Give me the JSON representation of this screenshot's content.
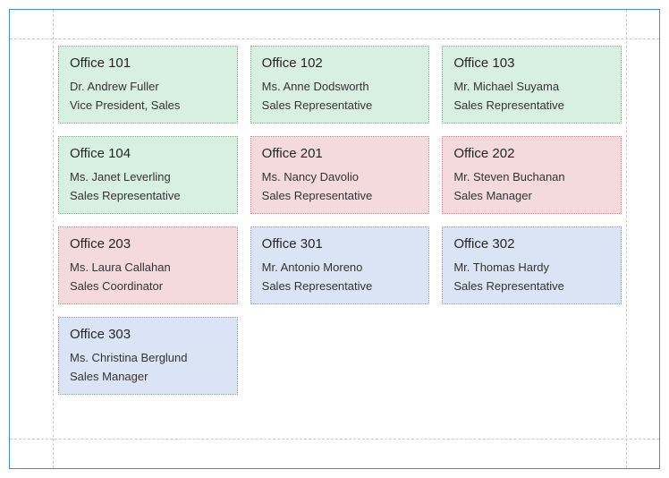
{
  "colors": {
    "green": {
      "bg": "#d8f0e2",
      "border": "#6fb98a"
    },
    "pink": {
      "bg": "#f4dadd",
      "border": "#cf8a93"
    },
    "blue": {
      "bg": "#dbe4f4",
      "border": "#8aa1cf"
    },
    "page_border": "#3a8fd6"
  },
  "cards": [
    {
      "office": "Office 101",
      "person": "Dr. Andrew Fuller",
      "role": "Vice President, Sales",
      "color": "green"
    },
    {
      "office": "Office 102",
      "person": "Ms. Anne Dodsworth",
      "role": "Sales Representative",
      "color": "green"
    },
    {
      "office": "Office 103",
      "person": "Mr. Michael Suyama",
      "role": "Sales Representative",
      "color": "green"
    },
    {
      "office": "Office 104",
      "person": "Ms. Janet Leverling",
      "role": "Sales Representative",
      "color": "green"
    },
    {
      "office": "Office 201",
      "person": "Ms. Nancy Davolio",
      "role": "Sales Representative",
      "color": "pink"
    },
    {
      "office": "Office 202",
      "person": "Mr. Steven Buchanan",
      "role": "Sales Manager",
      "color": "pink"
    },
    {
      "office": "Office 203",
      "person": "Ms. Laura Callahan",
      "role": "Sales Coordinator",
      "color": "pink"
    },
    {
      "office": "Office 301",
      "person": "Mr. Antonio Moreno",
      "role": "Sales Representative",
      "color": "blue"
    },
    {
      "office": "Office 302",
      "person": "Mr. Thomas Hardy",
      "role": "Sales Representative",
      "color": "blue"
    },
    {
      "office": "Office 303",
      "person": "Ms. Christina Berglund",
      "role": "Sales Manager",
      "color": "blue"
    }
  ]
}
